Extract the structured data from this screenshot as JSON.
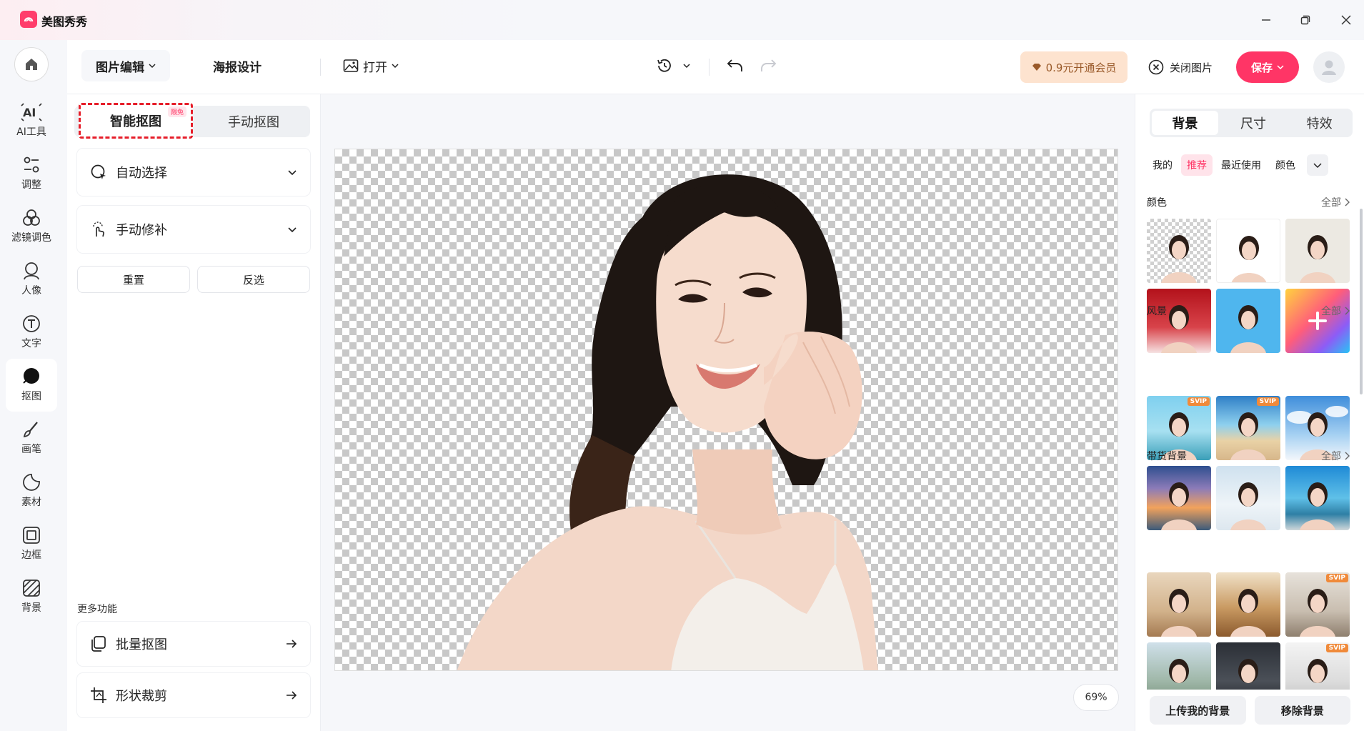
{
  "app": {
    "name": "美图秀秀"
  },
  "toolbar": {
    "tab_active": "图片编辑",
    "tab_poster": "海报设计",
    "open_label": "打开",
    "vip_label": "0.9元开通会员",
    "close_image_label": "关闭图片",
    "save_label": "保存"
  },
  "nav": {
    "items": [
      {
        "label": "AI工具",
        "icon": "ai-icon"
      },
      {
        "label": "调整",
        "icon": "adjust-icon"
      },
      {
        "label": "滤镜调色",
        "icon": "filter-icon"
      },
      {
        "label": "人像",
        "icon": "portrait-icon"
      },
      {
        "label": "文字",
        "icon": "text-icon"
      },
      {
        "label": "抠图",
        "icon": "cutout-icon",
        "active": true
      },
      {
        "label": "画笔",
        "icon": "brush-icon"
      },
      {
        "label": "素材",
        "icon": "sticker-icon"
      },
      {
        "label": "边框",
        "icon": "frame-icon"
      },
      {
        "label": "背景",
        "icon": "background-icon"
      }
    ]
  },
  "left_panel": {
    "mode_smart": "智能抠图",
    "mode_smart_badge": "限免",
    "mode_manual": "手动抠图",
    "auto_select": "自动选择",
    "manual_fix": "手动修补",
    "reset": "重置",
    "invert": "反选",
    "more_label": "更多功能",
    "batch_cutout": "批量抠图",
    "shape_crop": "形状裁剪"
  },
  "canvas": {
    "zoom": "69%"
  },
  "right_panel": {
    "tabs": [
      "背景",
      "尺寸",
      "特效"
    ],
    "filters": [
      "我的",
      "推荐",
      "最近使用",
      "颜色"
    ],
    "section_color": "颜色",
    "section_scenery": "风景",
    "section_ecommerce": "带货背景",
    "all_label": "全部",
    "svip_label": "SVIP",
    "upload_bg": "上传我的背景",
    "remove_bg": "移除背景"
  },
  "colors": {
    "accent": "#ff3566",
    "highlight_border": "#e61e2a",
    "vip_bg": "#fde3cf"
  }
}
